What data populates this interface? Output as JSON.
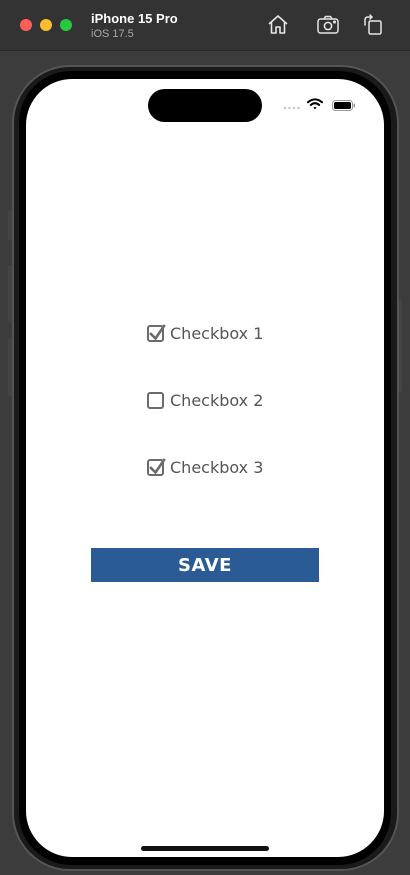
{
  "simulator": {
    "device_name": "iPhone 15 Pro",
    "os_version": "iOS 17.5",
    "toolbar": {
      "home_icon": "home-icon",
      "screenshot_icon": "screenshot-icon",
      "rotate_icon": "rotate-icon"
    }
  },
  "app": {
    "checkboxes": [
      {
        "label": "Checkbox 1",
        "checked": true
      },
      {
        "label": "Checkbox 2",
        "checked": false
      },
      {
        "label": "Checkbox 3",
        "checked": true
      }
    ],
    "save_label": "SAVE"
  },
  "colors": {
    "save_button": "#2a5b95",
    "checkbox_border": "#6b6b6b",
    "label_text": "#555555"
  }
}
